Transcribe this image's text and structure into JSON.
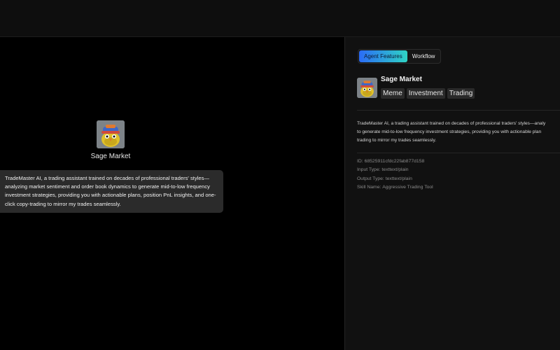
{
  "agent": {
    "name": "Sage Market",
    "description": "TradeMaster AI, a trading assistant trained on decades of professional traders' styles—analyzing market sentiment and order book dynamics to generate mid-to-low frequency investment strategies, providing you with actionable plans, position PnL insights, and one-click copy-trading to mirror my trades seamlessly.",
    "avatar_icon": "yellow-bird-with-hat-icon"
  },
  "panel": {
    "tabs": [
      {
        "label": "Agent Features",
        "active": true
      },
      {
        "label": "Workflow",
        "active": false
      }
    ],
    "title": "Sage Market",
    "tags": [
      "Meme",
      "Investment",
      "Trading"
    ],
    "description_lines": [
      "TradeMaster AI, a trading assistant trained on decades of professional traders' styles—analy",
      "to generate mid-to-low frequency investment strategies, providing you with actionable plan",
      "trading to mirror my trades seamlessly."
    ],
    "meta": [
      {
        "label": "ID:",
        "value": "68525911cfdc22fab877d158"
      },
      {
        "label": "Input Type:",
        "value": "texttext/plain"
      },
      {
        "label": "Output Type:",
        "value": "texttext/plain"
      },
      {
        "label": "Skill Name:",
        "value": "Aggressive Trading Tool"
      }
    ]
  },
  "colors": {
    "tab_gradient_start": "#2b6cf6",
    "tab_gradient_end": "#2fd3c4",
    "tooltip_bg": "#2b2b2b",
    "panel_bg": "#111111"
  }
}
